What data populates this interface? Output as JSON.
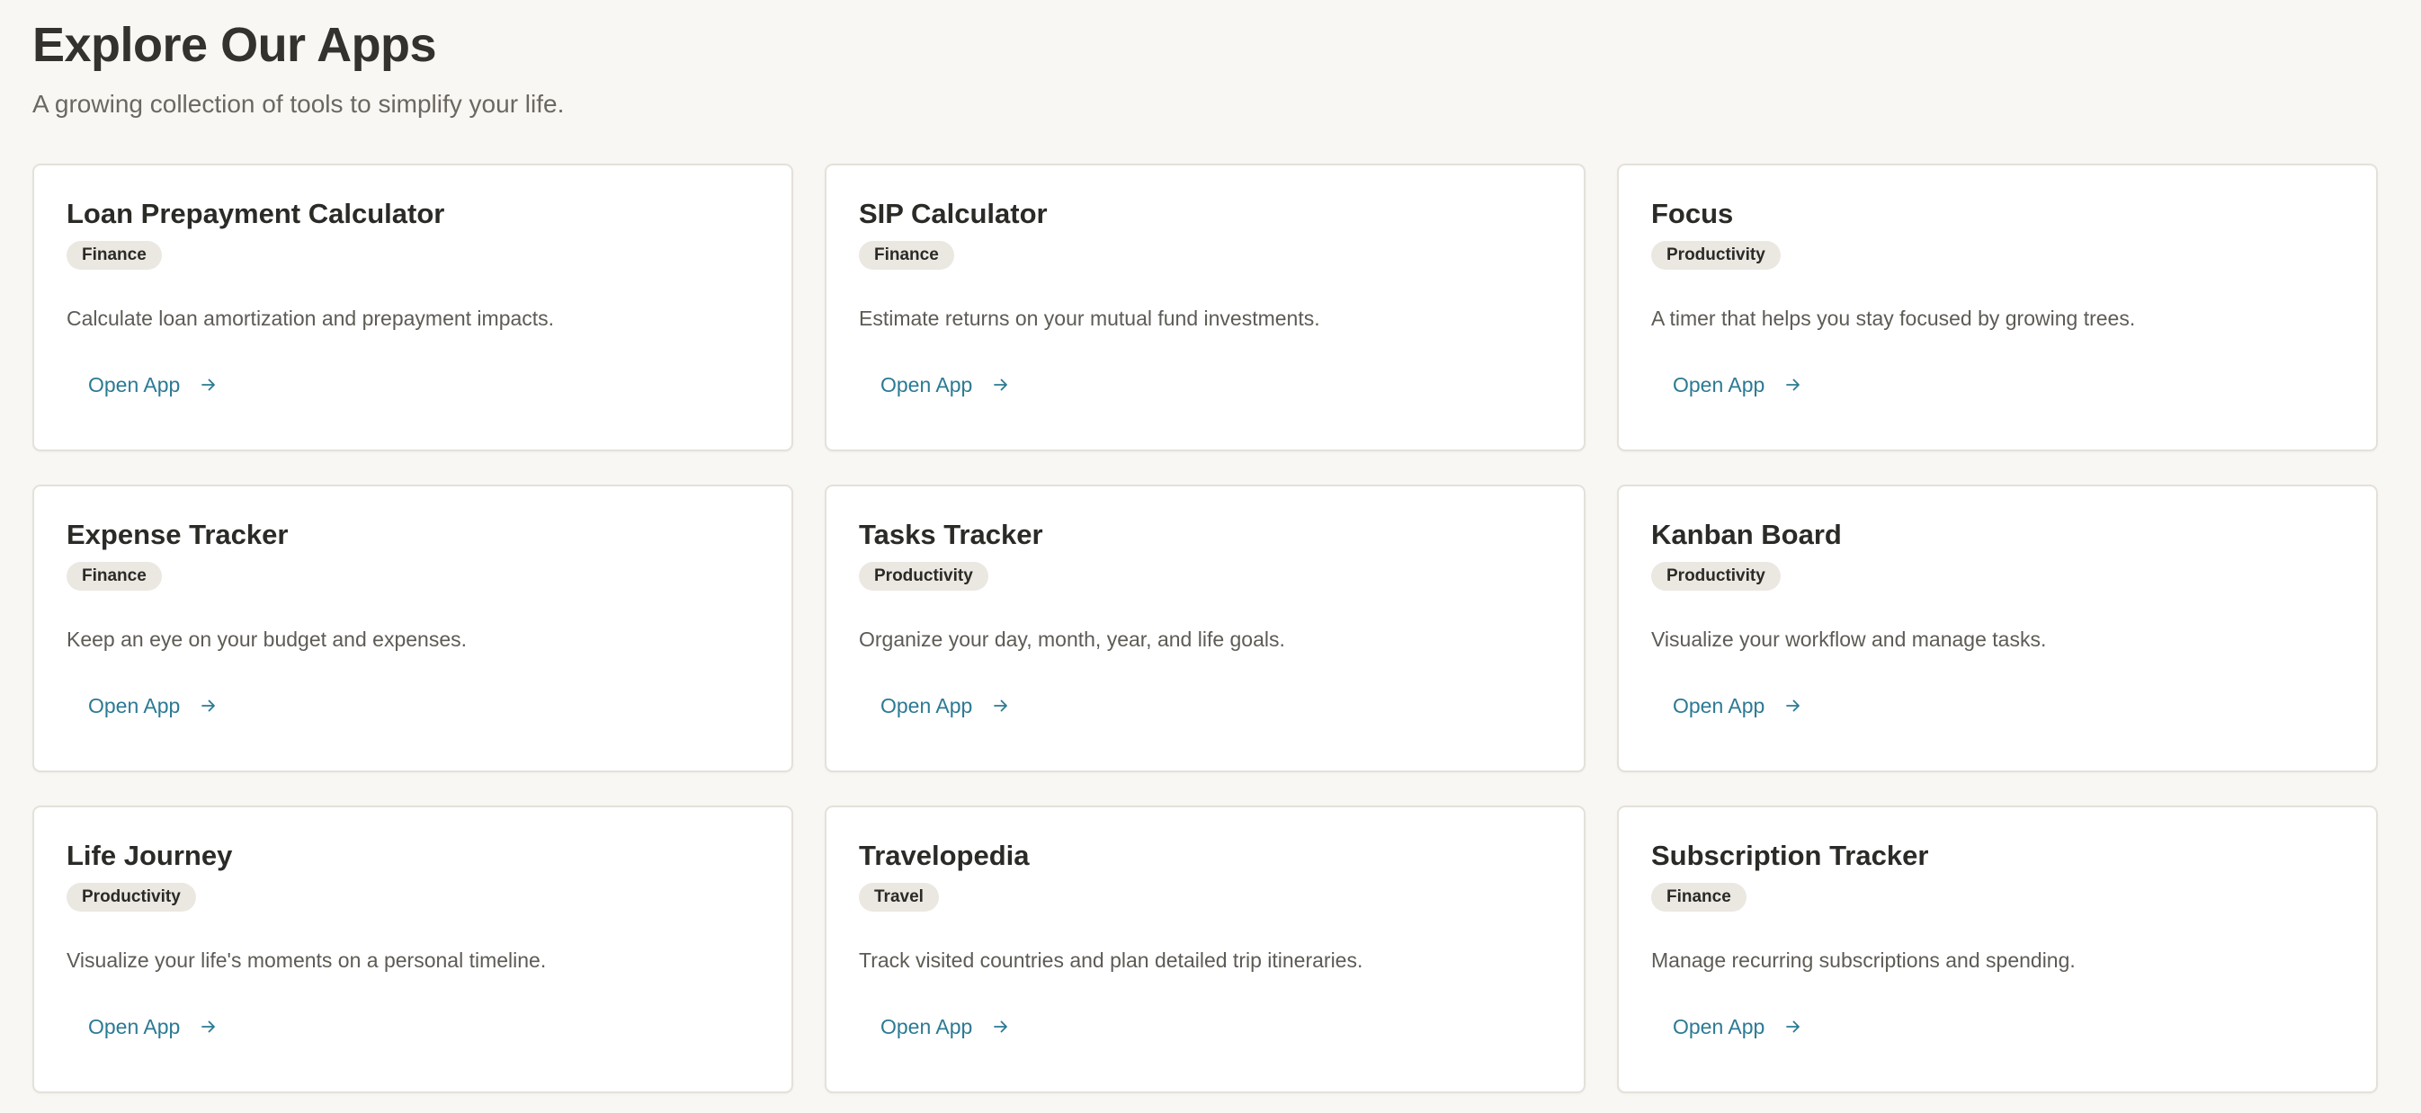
{
  "header": {
    "title": "Explore Our Apps",
    "subtitle": "A growing collection of tools to simplify your life."
  },
  "apps": [
    {
      "title": "Loan Prepayment Calculator",
      "category": "Finance",
      "description": "Calculate loan amortization and prepayment impacts.",
      "action_label": "Open App",
      "action_icon": "arrow-right-icon"
    },
    {
      "title": "SIP Calculator",
      "category": "Finance",
      "description": "Estimate returns on your mutual fund investments.",
      "action_label": "Open App",
      "action_icon": "arrow-right-icon"
    },
    {
      "title": "Focus",
      "category": "Productivity",
      "description": "A timer that helps you stay focused by growing trees.",
      "action_label": "Open App",
      "action_icon": "arrow-right-icon"
    },
    {
      "title": "Expense Tracker",
      "category": "Finance",
      "description": "Keep an eye on your budget and expenses.",
      "action_label": "Open App",
      "action_icon": "arrow-right-icon"
    },
    {
      "title": "Tasks Tracker",
      "category": "Productivity",
      "description": "Organize your day, month, year, and life goals.",
      "action_label": "Open App",
      "action_icon": "arrow-right-icon"
    },
    {
      "title": "Kanban Board",
      "category": "Productivity",
      "description": "Visualize your workflow and manage tasks.",
      "action_label": "Open App",
      "action_icon": "arrow-right-icon"
    },
    {
      "title": "Life Journey",
      "category": "Productivity",
      "description": "Visualize your life's moments on a personal timeline.",
      "action_label": "Open App",
      "action_icon": "arrow-right-icon"
    },
    {
      "title": "Travelopedia",
      "category": "Travel",
      "description": "Track visited countries and plan detailed trip itineraries.",
      "action_label": "Open App",
      "action_icon": "arrow-right-icon"
    },
    {
      "title": "Subscription Tracker",
      "category": "Finance",
      "description": "Manage recurring subscriptions and spending.",
      "action_label": "Open App",
      "action_icon": "arrow-right-icon"
    }
  ],
  "colors": {
    "page_background": "#f8f7f3",
    "card_background": "#ffffff",
    "card_border": "#e4e1da",
    "badge_background": "#ebe8e2",
    "link_accent": "#2b7a94",
    "title_text": "#34322e",
    "body_text": "#5e5b55"
  }
}
